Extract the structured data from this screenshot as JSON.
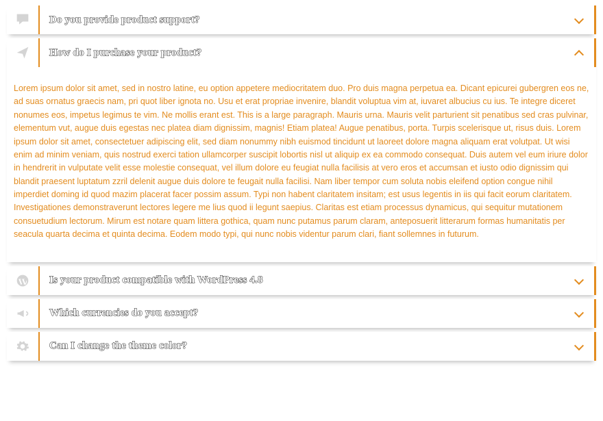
{
  "colors": {
    "accent": "#e38c1f",
    "icon_inactive": "#d4d4d4",
    "body_text": "#e38c1f"
  },
  "items": [
    {
      "icon": "comment-icon",
      "title": "Do you provide product support?",
      "open": false,
      "body": ""
    },
    {
      "icon": "paper-plane-icon",
      "title": "How do I purchase your product?",
      "open": true,
      "body": "Lorem ipsum dolor sit amet, sed in nostro latine, eu option appetere mediocritatem duo. Pro duis magna perpetua ea. Dicant epicurei gubergren eos ne, ad suas ornatus graecis nam, pri quot liber ignota no. Usu et erat propriae invenire, blandit voluptua vim at, iuvaret albucius cu ius. Te integre diceret nonumes eos, impetus legimus te vim. Ne mollis erant est.\nThis is a large paragraph. Mauris urna. Mauris velit parturient sit penatibus sed cras pulvinar, elementum vut, augue duis egestas nec platea diam dignissim, magnis! Etiam platea! Augue penatibus, porta. Turpis scelerisque ut, risus duis.\nLorem ipsum dolor sit amet, consectetuer adipiscing elit, sed diam nonummy nibh euismod tincidunt ut laoreet dolore magna aliquam erat volutpat. Ut wisi enim ad minim veniam, quis nostrud exerci tation ullamcorper suscipit lobortis nisl ut aliquip ex ea commodo consequat. Duis autem vel eum iriure dolor in hendrerit in vulputate velit esse molestie consequat, vel illum dolore eu feugiat nulla facilisis at vero eros et accumsan et iusto odio dignissim qui blandit praesent luptatum zzril delenit augue duis dolore te feugait nulla facilisi. Nam liber tempor cum soluta nobis eleifend option congue nihil imperdiet doming id quod mazim placerat facer possim assum. Typi non habent claritatem insitam; est usus legentis in iis qui facit eorum claritatem. Investigationes demonstraverunt lectores legere me lius quod ii legunt saepius. Claritas est etiam processus dynamicus, qui sequitur mutationem consuetudium lectorum. Mirum est notare quam littera gothica, quam nunc putamus parum claram, anteposuerit litterarum formas humanitatis per seacula quarta decima et quinta decima. Eodem modo typi, qui nunc nobis videntur parum clari, fiant sollemnes in futurum."
    },
    {
      "icon": "wordpress-icon",
      "title": "Is your product compatible with WordPress 4.8",
      "open": false,
      "body": ""
    },
    {
      "icon": "bullhorn-icon",
      "title": "Which currencies do you accept?",
      "open": false,
      "body": ""
    },
    {
      "icon": "gear-icon",
      "title": "Can I change the theme color?",
      "open": false,
      "body": ""
    }
  ]
}
